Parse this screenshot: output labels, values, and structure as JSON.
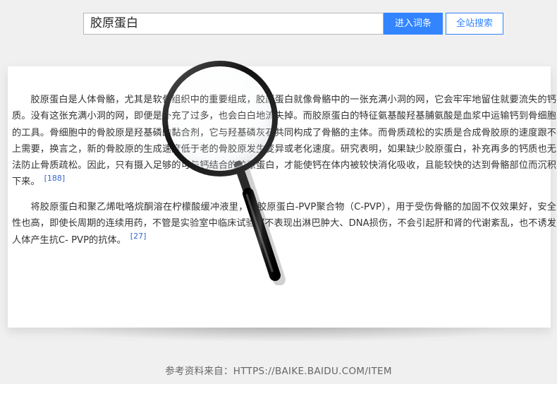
{
  "search": {
    "value": "胶原蛋白",
    "enter_button": "进入词条",
    "site_search_button": "全站搜索"
  },
  "article": {
    "paragraph1": "胶原蛋白是人体骨骼，尤其是软骨组织中的重要组成，胶原蛋白就像骨骼中的一张充满小洞的网，它会牢牢地留住就要流失的钙质。没有这张充满小洞的网，即便是补充了过多，也会白白地流失掉。而胶原蛋白的特征氨基酸羟基脯氨酸是血浆中运输钙到骨细胞的工具。骨细胞中的骨胶原是羟基磷的黏合剂，它与羟基磷灰石共同构成了骨骼的主体。而骨质疏松的实质是合成骨胶原的速度跟不上需要，换言之，新的骨胶原的生成速度低于老的骨胶原发生变异或老化速度。研究表明，如果缺少胶原蛋白，补充再多的钙质也无法防止骨质疏松。因此，只有摄入足够的可与钙结合的胶原蛋白，才能使钙在体内被较快消化吸收，且能较快的达到骨骼部位而沉积下来。",
    "ref1": "[188]",
    "paragraph2": "将胶原蛋白和聚乙烯吡咯烷酮溶在柠檬酸缓冲液里，得胶原蛋白-PVP聚合物（C-PVP），用于受伤骨骼的加固不仅效果好，安全性也高，即使长周期的连续用药，不管是实验室中临床试验都不表现出淋巴肿大、DNA损伤，不会引起肝和肾的代谢紊乱，也不诱发人体产生抗C- PVP的抗体。",
    "ref2": "[27]"
  },
  "footer": {
    "source": "参考资料来自：HTTPS://BAIKE.BAIDU.COM/ITEM"
  },
  "colors": {
    "accent": "#3385ff",
    "link": "#3366cc",
    "text": "#333333",
    "background": "#f0f0f0"
  },
  "icons": {
    "decoration": "magnifying-glass-icon"
  }
}
